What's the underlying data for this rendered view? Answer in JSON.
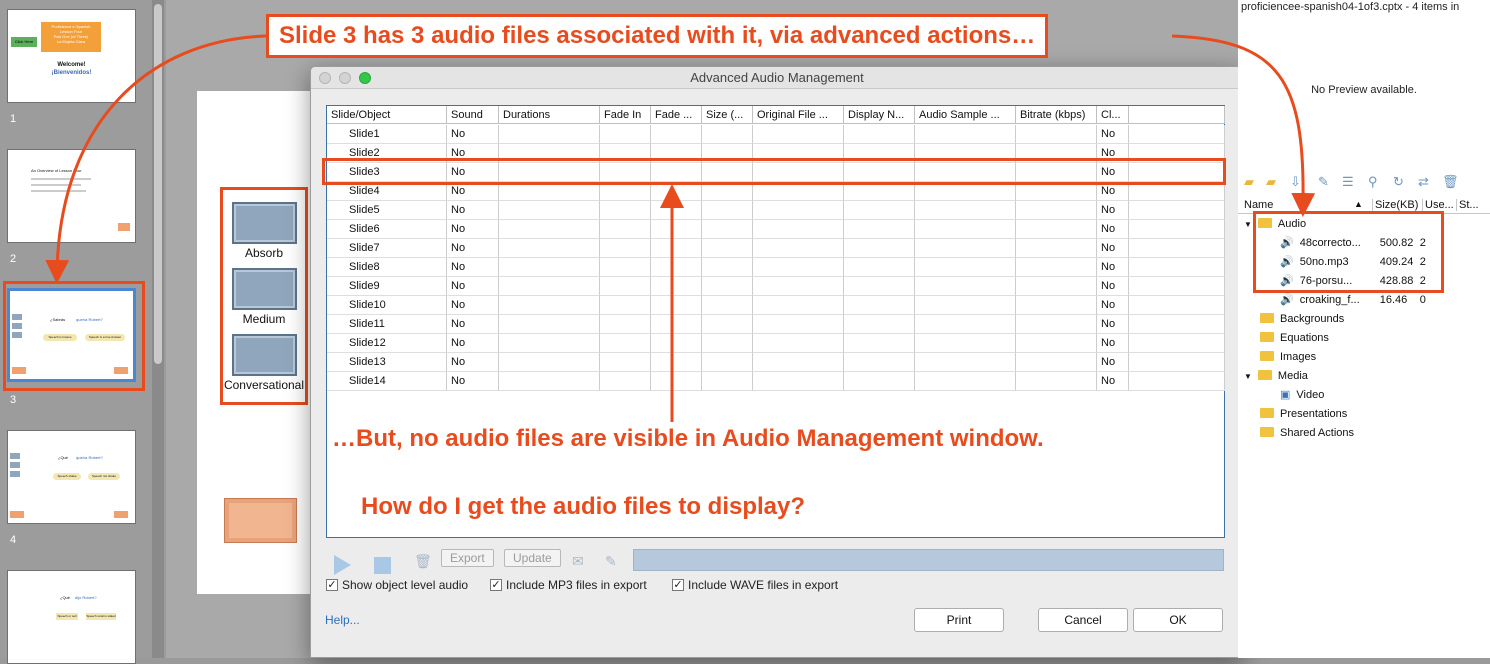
{
  "filmstrip": {
    "slides": [
      {
        "num": "1",
        "title_lines": [
          "Proficience e-Spanish",
          "Lesson Four",
          "Part One (of Three)",
          "La Mujeta Clara"
        ],
        "welcome": "Welcome!",
        "bienvenidos": "¡Bienvenidos!",
        "button": "Click Here"
      },
      {
        "num": "2",
        "heading": "An Overview of Lesson Four"
      },
      {
        "num": "3",
        "q_left": "¿Sabrás",
        "q_right": "quería Robert?",
        "opt1": "Speech is Insane",
        "opt2": "Speech is a true Answer"
      },
      {
        "num": "4",
        "q_left": "¿Qué",
        "q_right": "quería Robert?",
        "opt1": "Speech shake",
        "opt2": "Speech not shake"
      },
      {
        "num": "5",
        "q_left": "¿Qué",
        "q_right": "dijo Robert?",
        "opt1": "Speech or sell",
        "opt2": "Speech returns stated"
      }
    ]
  },
  "canvas": {
    "speakers": [
      "Absorb",
      "Medium",
      "Conversational"
    ]
  },
  "dialog": {
    "title": "Advanced Audio Management",
    "columns": [
      "Slide/Object",
      "Sound",
      "Durations",
      "Fade In",
      "Fade ...",
      "Size (...",
      "Original File ...",
      "Display N...",
      "Audio Sample ...",
      "Bitrate (kbps)",
      "Cl...",
      ""
    ],
    "rows": [
      {
        "slide": "Slide1",
        "sound": "No",
        "cl": "No"
      },
      {
        "slide": "Slide2",
        "sound": "No",
        "cl": "No"
      },
      {
        "slide": "Slide3",
        "sound": "No",
        "cl": "No"
      },
      {
        "slide": "Slide4",
        "sound": "No",
        "cl": "No"
      },
      {
        "slide": "Slide5",
        "sound": "No",
        "cl": "No"
      },
      {
        "slide": "Slide6",
        "sound": "No",
        "cl": "No"
      },
      {
        "slide": "Slide7",
        "sound": "No",
        "cl": "No"
      },
      {
        "slide": "Slide8",
        "sound": "No",
        "cl": "No"
      },
      {
        "slide": "Slide9",
        "sound": "No",
        "cl": "No"
      },
      {
        "slide": "Slide10",
        "sound": "No",
        "cl": "No"
      },
      {
        "slide": "Slide11",
        "sound": "No",
        "cl": "No"
      },
      {
        "slide": "Slide12",
        "sound": "No",
        "cl": "No"
      },
      {
        "slide": "Slide13",
        "sound": "No",
        "cl": "No"
      },
      {
        "slide": "Slide14",
        "sound": "No",
        "cl": "No"
      }
    ],
    "toolbar": {
      "export": "Export",
      "update": "Update"
    },
    "checkboxes": [
      {
        "label": "Show object level audio",
        "checked": true
      },
      {
        "label": "Include MP3 files in export",
        "checked": true
      },
      {
        "label": "Include WAVE files in export",
        "checked": true
      }
    ],
    "help": "Help...",
    "buttons": {
      "print": "Print",
      "cancel": "Cancel",
      "ok": "OK"
    }
  },
  "library": {
    "title": "proficiencee-spanish04-1of3.cptx - 4 items in",
    "preview": "No Preview available.",
    "headers": {
      "name": "Name",
      "size": "Size(KB)",
      "use": "Use...",
      "status": "St..."
    },
    "audio_folder": "Audio",
    "audio_items": [
      {
        "name": "48correcto...",
        "size": "500.82",
        "use": "2"
      },
      {
        "name": "50no.mp3",
        "size": "409.24",
        "use": "2"
      },
      {
        "name": "76-porsu...",
        "size": "428.88",
        "use": "2"
      },
      {
        "name": "croaking_f...",
        "size": "16.46",
        "use": "0"
      }
    ],
    "folders": [
      "Backgrounds",
      "Equations",
      "Images",
      "Media",
      "Video",
      "Presentations",
      "Shared Actions"
    ]
  },
  "annotations": {
    "top": "Slide 3 has 3 audio files associated with it, via advanced actions…",
    "middle": "…But, no audio files are visible in Audio Management window.",
    "question": "How do I get the audio files to display?"
  },
  "colors": {
    "annotation": "#e84c1e",
    "selection": "#3b73a6"
  }
}
